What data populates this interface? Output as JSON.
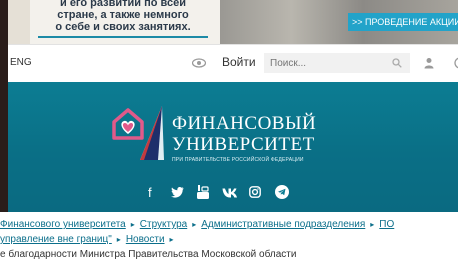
{
  "banner": {
    "text_lines": [
      "и его развитии по всей",
      "стране, а также немного",
      "о себе и своих занятиях."
    ],
    "cta_label": ">> ПРОВЕДЕНИЕ АКЦИИ"
  },
  "topbar": {
    "lang": "ENG",
    "login_label": "Войти",
    "search_placeholder": "Поиск..."
  },
  "hero": {
    "title_line1": "ФИНАНСОВЫЙ",
    "title_line2": "УНИВЕРСИТЕТ",
    "subtitle": "ПРИ ПРАВИТЕЛЬСТВЕ РОССИЙСКОЙ ФЕДЕРАЦИИ",
    "social_icons": [
      "facebook-icon",
      "twitter-icon",
      "youtube-icon",
      "vk-icon",
      "instagram-icon",
      "telegram-icon"
    ]
  },
  "breadcrumb": {
    "row1": [
      "Финансового университета",
      "Структура",
      "Административные подразделения",
      "ПО"
    ],
    "row2": [
      "управление вне границ\"",
      "Новости"
    ],
    "current": "е благодарности Министра Правительства Московской области"
  },
  "colors": {
    "hero_bg": "#0c7d93",
    "link": "#0c6f8b",
    "cta": "#22a3c9"
  }
}
